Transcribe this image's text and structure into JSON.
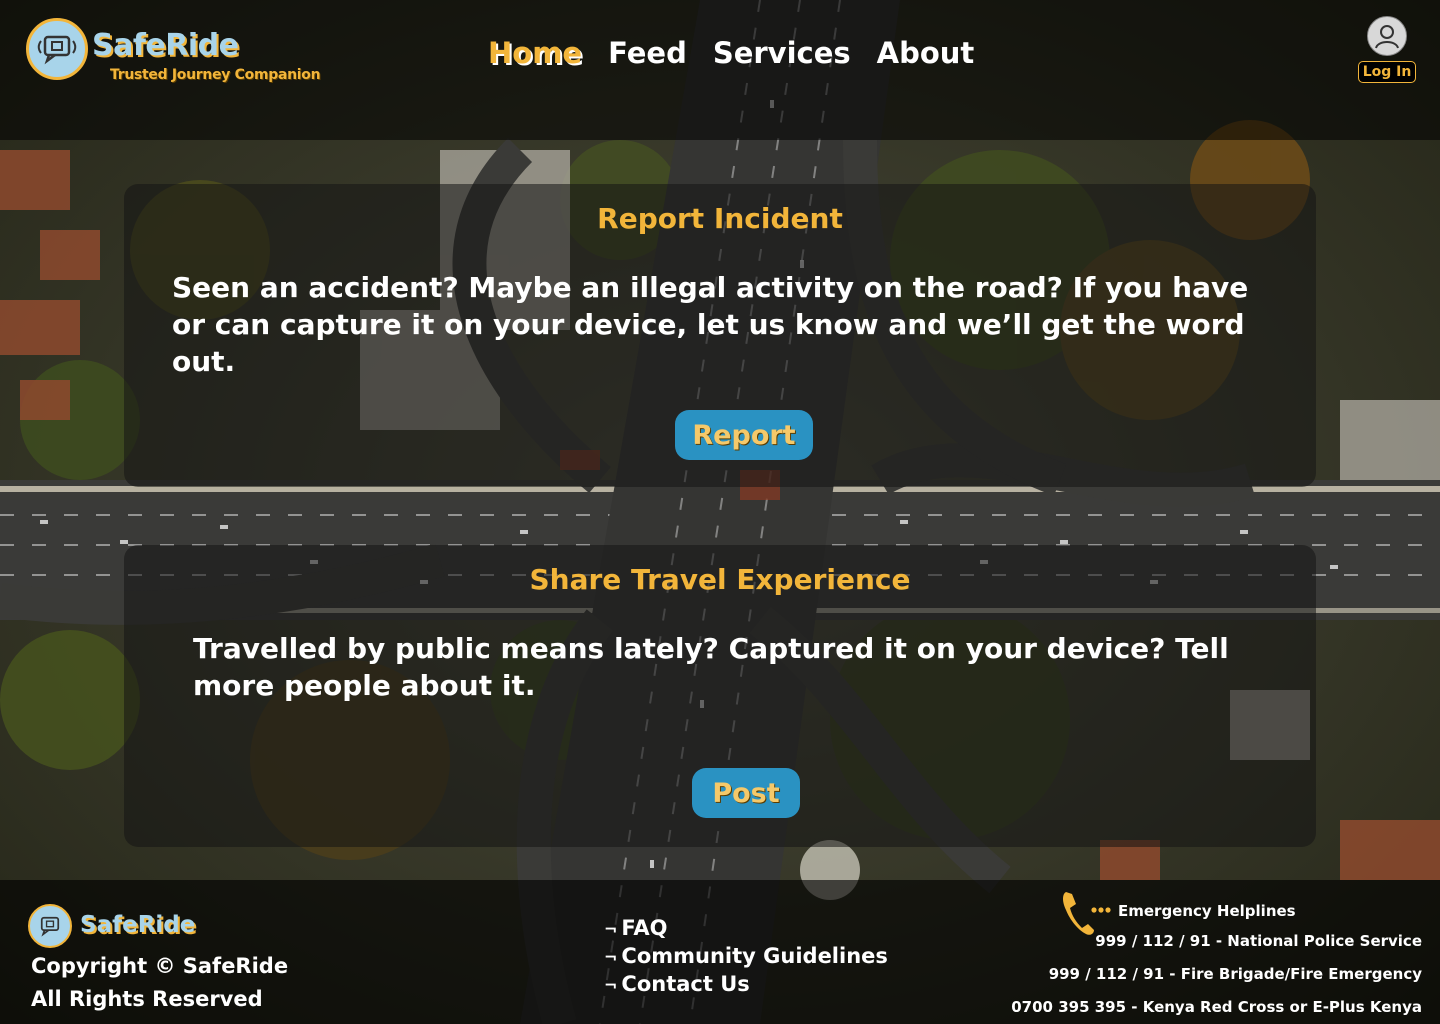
{
  "brand": {
    "name": "SafeRide",
    "tagline": "Trusted Journey Companion"
  },
  "nav": {
    "items": [
      "Home",
      "Feed",
      "Services",
      "About"
    ],
    "active": "Home"
  },
  "user": {
    "login_label": "Log In"
  },
  "report_card": {
    "title": "Report Incident",
    "body": "Seen an accident? Maybe an illegal activity on the road? If you have or can capture it on your device, let us know and we’ll get the word out.",
    "button_label": "Report"
  },
  "share_card": {
    "title": "Share Travel Experience",
    "body": "Travelled by public means lately? Captured it on your device? Tell more people about it.",
    "button_label": "Post"
  },
  "footer": {
    "brand_name": "SafeRide",
    "copyright": "Copyright © SafeRide",
    "rights": "All Rights Reserved",
    "links": [
      "FAQ",
      "Community Guidelines",
      "Contact Us"
    ],
    "link_bullet": "¬",
    "emergency": {
      "title": "Emergency Helplines",
      "lines": [
        "999 / 112 / 91 - National Police Service",
        "999 / 112 / 91 - Fire Brigade/Fire Emergency",
        "0700 395 395 - Kenya Red Cross or E-Plus Kenya"
      ]
    }
  },
  "colors": {
    "accent": "#f2b53a",
    "brand_blue": "#a8d4ea",
    "button_blue": "#2a92c2"
  },
  "icons": {
    "logo": "chat-bubble-logo-icon",
    "user": "user-avatar-icon",
    "phone": "phone-icon"
  }
}
